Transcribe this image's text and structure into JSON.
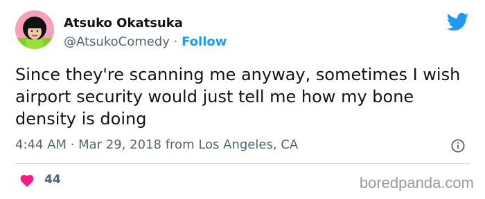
{
  "tweet": {
    "author_name": "Atsuko Okatsuka",
    "handle": "@AtsukoComedy",
    "separator": "·",
    "follow_label": "Follow",
    "text": "Since they're scanning me anyway, sometimes I wish airport security would just tell me how my bone density is doing",
    "timestamp": "4:44 AM · Mar 29, 2018 from Los Angeles, CA",
    "like_count": "44"
  },
  "watermark": "boredpanda.com",
  "icons": {
    "platform": "twitter-bird-icon",
    "info": "info-icon",
    "like": "heart-icon"
  },
  "colors": {
    "accent": "#1d9bf0",
    "like": "#f91880",
    "muted_text": "#536471",
    "divider": "#cfd9de"
  }
}
